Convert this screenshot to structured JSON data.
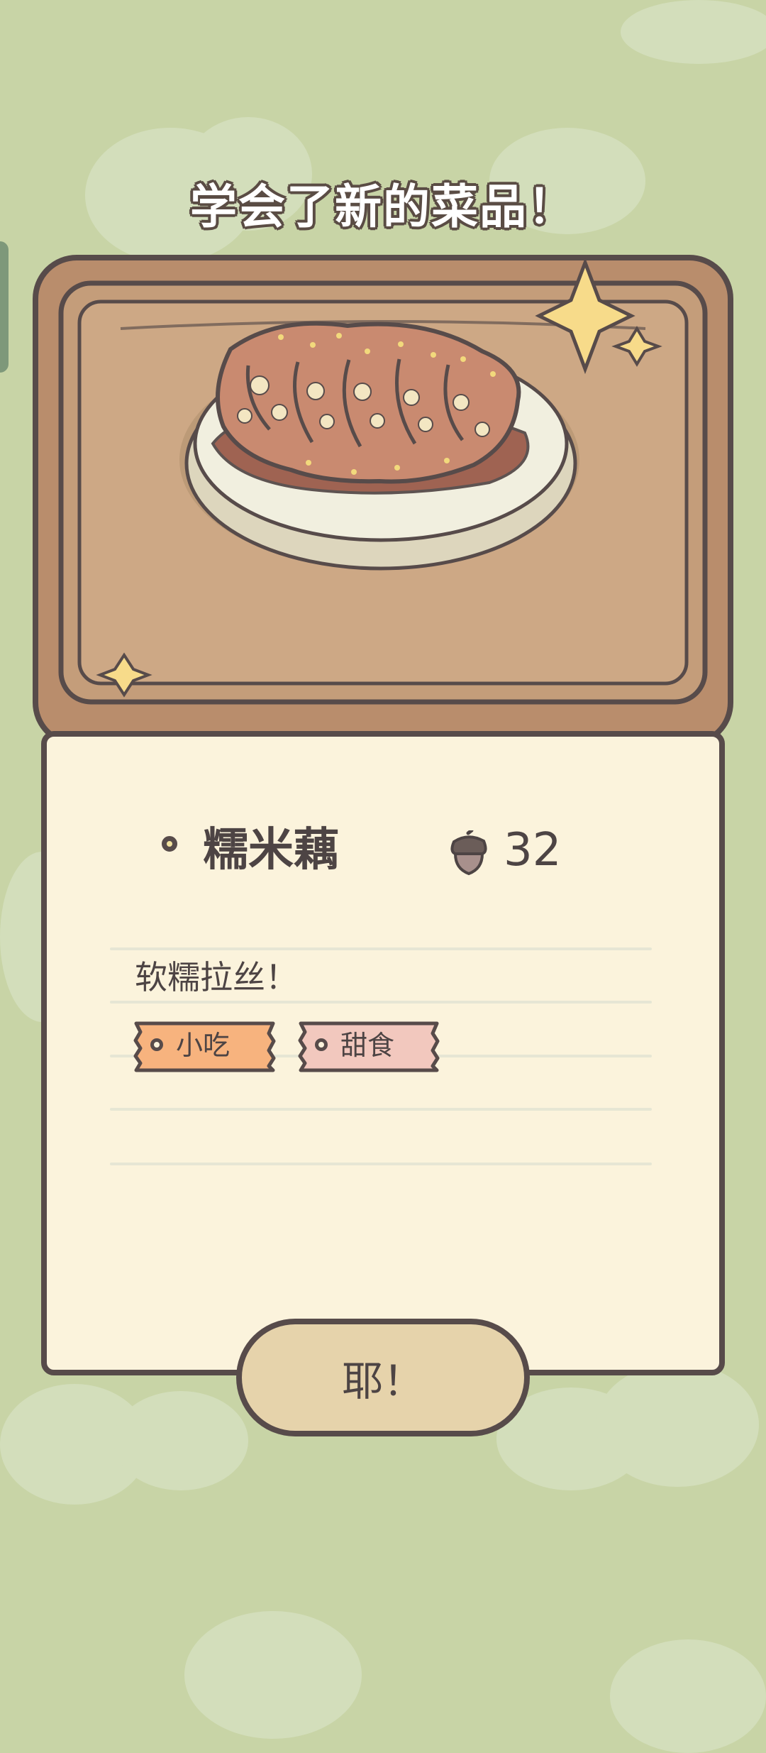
{
  "banner": {
    "title": "学会了新的菜品！"
  },
  "dish": {
    "name": "糯米藕",
    "price": "32",
    "description": "软糯拉丝！",
    "tags": [
      "小吃",
      "甜食"
    ]
  },
  "actions": {
    "confirm_label": "耶！"
  },
  "icons": {
    "price": "acorn-icon",
    "dish": "lotus-root-dish-icon"
  },
  "colors": {
    "background": "#c8d4a6",
    "card": "#fbf3dc",
    "outline": "#574b4a",
    "tag_snack": "#f7b37e",
    "tag_dessert": "#f2c8be",
    "button": "#e6d3ab"
  }
}
